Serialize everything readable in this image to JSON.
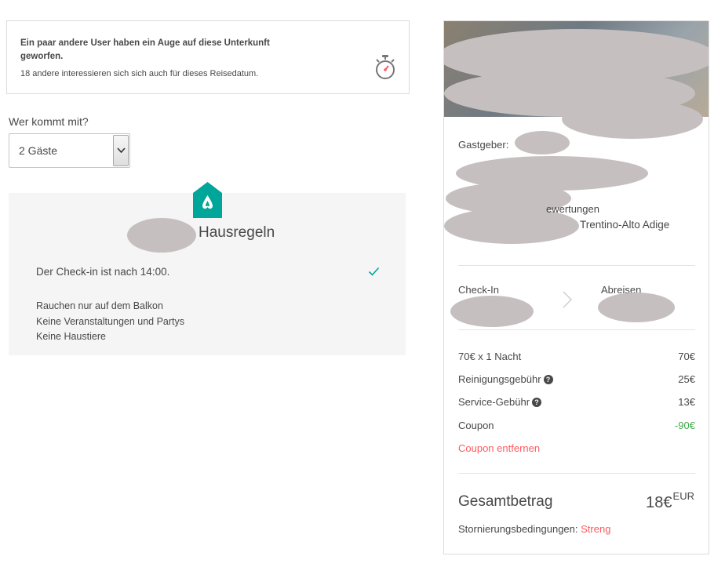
{
  "interest_notice": {
    "title": "Ein paar andere User haben ein Auge auf diese Unterkunft geworfen.",
    "text": "18 andere interessieren sich sich auch für dieses Reisedatum.",
    "icon": "stopwatch-icon"
  },
  "guests": {
    "label": "Wer kommt mit?",
    "selected": "2 Gäste"
  },
  "house_rules": {
    "title": "Hausregeln",
    "checkin": "Der Check-in ist nach 14:00.",
    "rules": [
      "Rauchen nur auf dem Balkon",
      "Keine Veranstaltungen und Partys",
      "Keine Haustiere"
    ]
  },
  "booking": {
    "host_label": "Gastgeber:",
    "reviews_fragment": "ewertungen",
    "location_fragment": "Trentino-Alto Adige",
    "checkin_label": "Check-In",
    "checkout_label": "Abreisen",
    "prices": [
      {
        "label": "70€ x 1 Nacht",
        "amount": "70€",
        "help": false
      },
      {
        "label": "Reinigungsgebühr",
        "amount": "25€",
        "help": true
      },
      {
        "label": "Service-Gebühr",
        "amount": "13€",
        "help": true
      },
      {
        "label": "Coupon",
        "amount": "-90€",
        "help": false
      }
    ],
    "help_glyph": "?",
    "coupon_remove": "Coupon entfernen",
    "total_label": "Gesamtbetrag",
    "total_amount": "18€",
    "currency": "EUR",
    "cancellation_label": "Stornierungsbedingungen:",
    "cancellation_value": "Streng"
  },
  "colors": {
    "accent_red": "#ff5a5f",
    "teal": "#00a699",
    "discount_green": "#3fa84a",
    "redaction": "#c6bfc0"
  }
}
